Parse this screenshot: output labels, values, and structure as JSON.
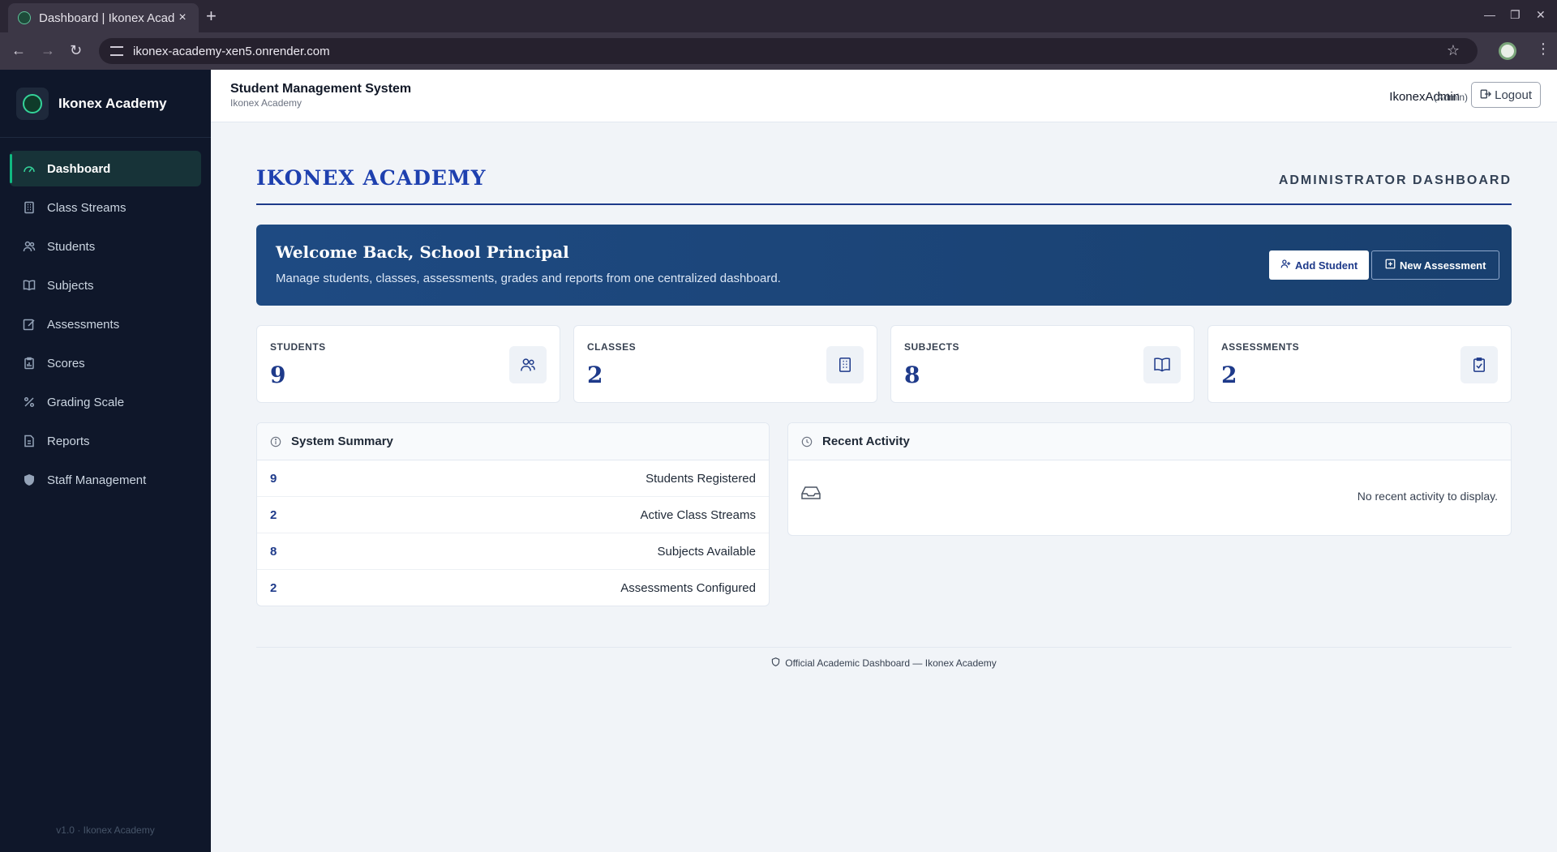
{
  "browser": {
    "tab_title": "Dashboard | Ikonex Acad",
    "url": "ikonex-academy-xen5.onrender.com"
  },
  "sidebar": {
    "brand": "Ikonex Academy",
    "items": [
      {
        "label": "Dashboard",
        "icon": "gauge-icon",
        "active": true
      },
      {
        "label": "Class Streams",
        "icon": "building-icon"
      },
      {
        "label": "Students",
        "icon": "users-icon"
      },
      {
        "label": "Subjects",
        "icon": "book-icon"
      },
      {
        "label": "Assessments",
        "icon": "edit-icon"
      },
      {
        "label": "Scores",
        "icon": "clipboard-data-icon"
      },
      {
        "label": "Grading Scale",
        "icon": "percent-icon"
      },
      {
        "label": "Reports",
        "icon": "file-icon"
      },
      {
        "label": "Staff Management",
        "icon": "shield-icon"
      }
    ],
    "version": "v1.0 · Ikonex Academy"
  },
  "header": {
    "title": "Student Management System",
    "subtitle": "Ikonex Academy",
    "user": "IkonexAdmin",
    "role": "(Admin)",
    "logout_label": "Logout"
  },
  "main": {
    "school_name": "IKONEX ACADEMY",
    "dashboard_label": "ADMINISTRATOR DASHBOARD",
    "welcome": {
      "title": "Welcome Back, School Principal",
      "subtitle": "Manage students, classes, assessments, grades and reports from one centralized dashboard.",
      "add_student_label": "Add Student",
      "new_assessment_label": "New Assessment"
    },
    "stats": [
      {
        "label": "STUDENTS",
        "value": "9",
        "icon": "users-icon"
      },
      {
        "label": "CLASSES",
        "value": "2",
        "icon": "building-icon"
      },
      {
        "label": "SUBJECTS",
        "value": "8",
        "icon": "book-icon"
      },
      {
        "label": "ASSESSMENTS",
        "value": "2",
        "icon": "clipboard-check-icon"
      }
    ],
    "summary": {
      "title": "System Summary",
      "rows": [
        {
          "value": "9",
          "label": "Students Registered"
        },
        {
          "value": "2",
          "label": "Active Class Streams"
        },
        {
          "value": "8",
          "label": "Subjects Available"
        },
        {
          "value": "2",
          "label": "Assessments Configured"
        }
      ]
    },
    "activity": {
      "title": "Recent Activity",
      "empty_text": "No recent activity to display."
    },
    "footer": "Official Academic Dashboard — Ikonex Academy"
  },
  "colors": {
    "sidebar_bg": "#0f172a",
    "accent_green": "#10b981",
    "brand_blue": "#1e3a8a",
    "banner_blue": "#1e4a82",
    "page_bg": "#f1f4f8"
  }
}
